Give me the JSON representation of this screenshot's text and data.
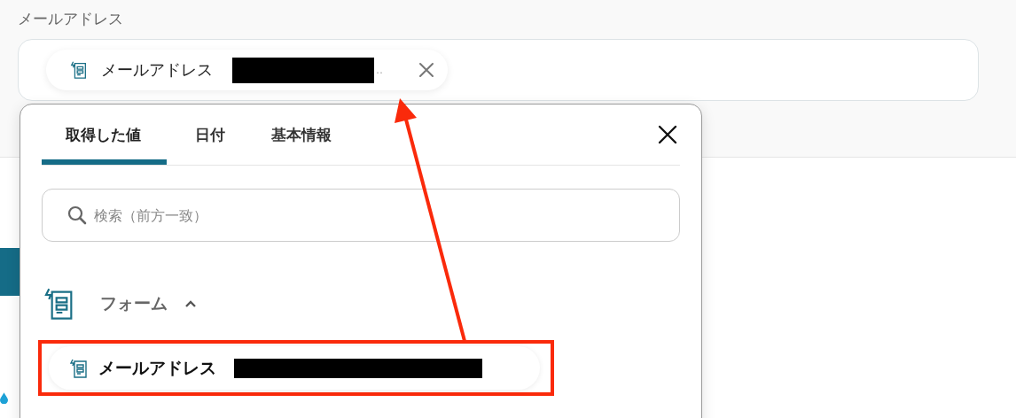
{
  "field": {
    "label": "メールアドレス",
    "chip": {
      "label": "メールアドレス",
      "ellipsis": "‥"
    }
  },
  "popup": {
    "tabs": [
      {
        "label": "取得した値",
        "selected": true
      },
      {
        "label": "日付",
        "selected": false
      },
      {
        "label": "基本情報",
        "selected": false
      }
    ],
    "search": {
      "placeholder": "検索（前方一致）"
    },
    "groups": [
      {
        "label": "フォーム",
        "expanded": true,
        "items": [
          {
            "label": "メールアドレス",
            "highlighted": true
          }
        ]
      }
    ]
  }
}
